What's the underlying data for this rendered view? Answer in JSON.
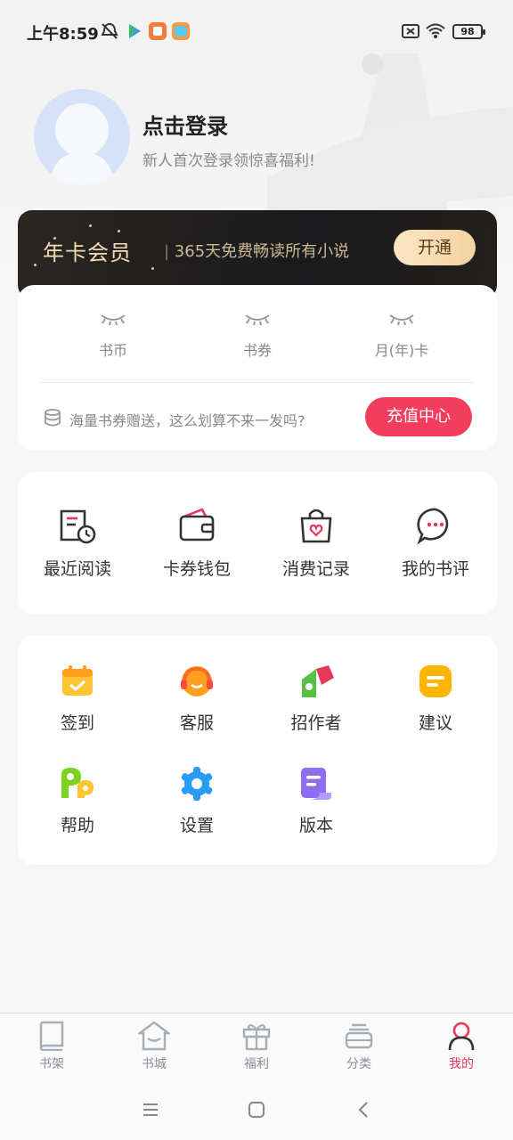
{
  "status_bar": {
    "time": "上午8:59",
    "battery": "98"
  },
  "profile": {
    "title": "点击登录",
    "subtitle": "新人首次登录领惊喜福利!"
  },
  "vip": {
    "title": "年卡会员",
    "description": "365天免费畅读所有小说",
    "button": "开通"
  },
  "wallet": {
    "items": [
      {
        "label": "书币"
      },
      {
        "label": "书券"
      },
      {
        "label": "月(年)卡"
      }
    ],
    "promo_text": "海量书券赠送，这么划算不来一发吗?",
    "recharge_button": "充值中心"
  },
  "features": [
    {
      "label": "最近阅读",
      "icon": "recent-reading-icon"
    },
    {
      "label": "卡券钱包",
      "icon": "wallet-icon"
    },
    {
      "label": "消费记录",
      "icon": "shopping-bag-icon"
    },
    {
      "label": "我的书评",
      "icon": "comment-icon"
    }
  ],
  "tools": [
    {
      "label": "签到",
      "icon": "calendar-check-icon"
    },
    {
      "label": "客服",
      "icon": "headset-icon"
    },
    {
      "label": "招作者",
      "icon": "author-icon"
    },
    {
      "label": "建议",
      "icon": "suggestion-icon"
    },
    {
      "label": "帮助",
      "icon": "help-icon"
    },
    {
      "label": "设置",
      "icon": "gear-icon"
    },
    {
      "label": "版本",
      "icon": "version-icon"
    }
  ],
  "bottom_nav": [
    {
      "label": "书架",
      "active": false
    },
    {
      "label": "书城",
      "active": false
    },
    {
      "label": "福利",
      "active": false
    },
    {
      "label": "分类",
      "active": false
    },
    {
      "label": "我的",
      "active": true
    }
  ],
  "colors": {
    "accent": "#f23d5c",
    "vip_gold": "#f4dcb2",
    "active_nav": "#e8385a"
  }
}
